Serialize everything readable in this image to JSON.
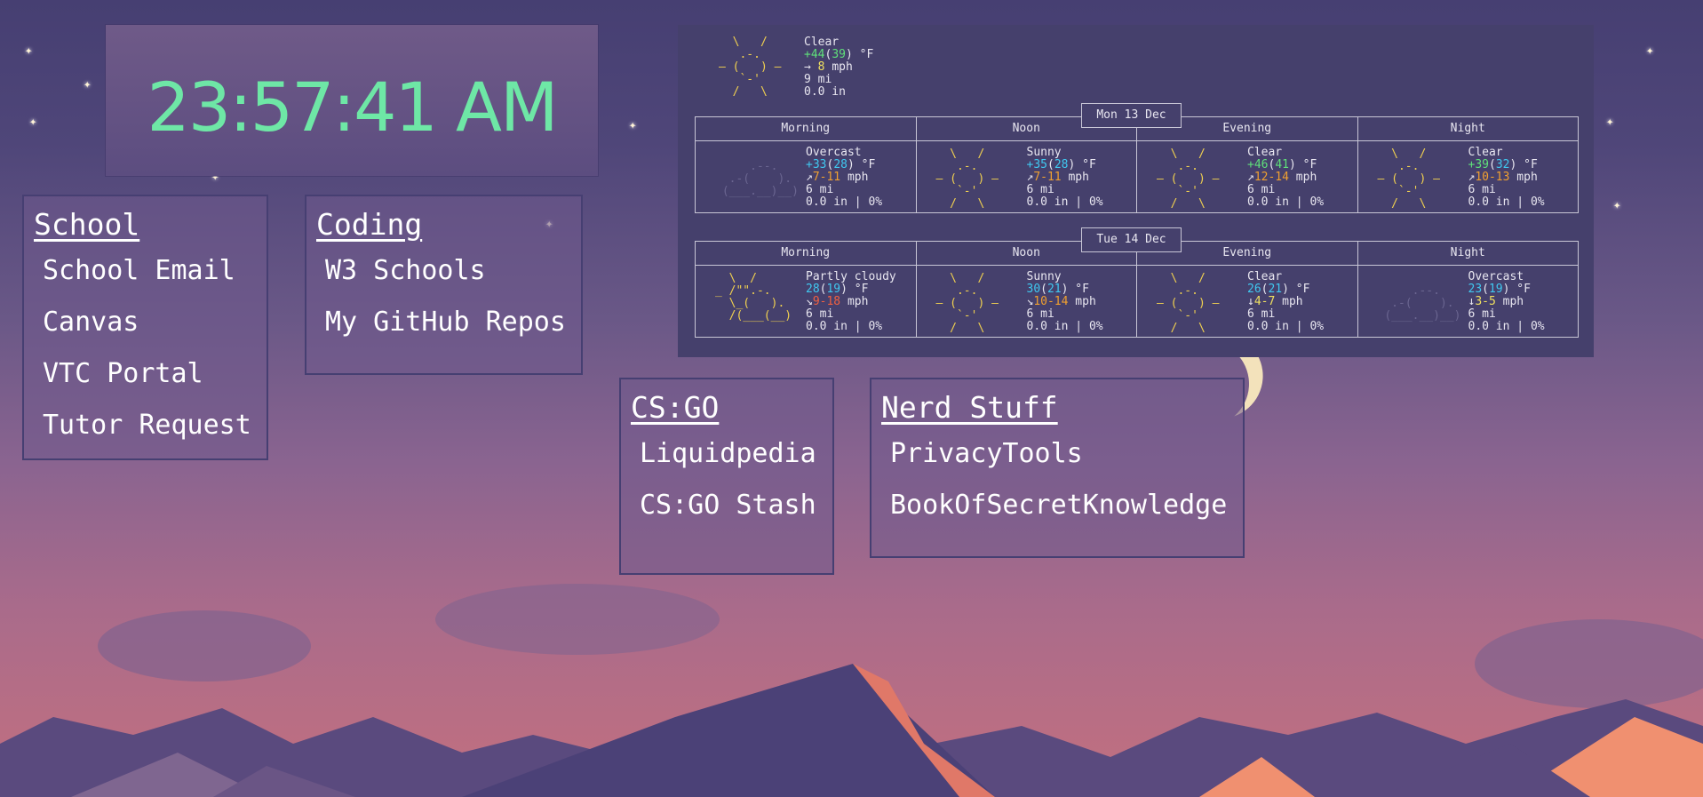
{
  "clock": {
    "time": "23:57:41 AM"
  },
  "groups": [
    {
      "title": "School",
      "links": [
        "School Email",
        "Canvas",
        "VTC Portal",
        "Tutor Request"
      ]
    },
    {
      "title": "Coding",
      "links": [
        "W3 Schools",
        "My GitHub Repos"
      ]
    },
    {
      "title": "CS:GO",
      "links": [
        "Liquidpedia",
        "CS:GO Stash"
      ]
    },
    {
      "title": "Nerd Stuff",
      "links": [
        "PrivacyTools",
        "BookOfSecretKnowledge"
      ]
    }
  ],
  "weather": {
    "current": {
      "condition": "Clear",
      "temp": "+44",
      "feels": "39",
      "unit": "°F",
      "wind_dir": "→",
      "wind": "8",
      "wind_unit": "mph",
      "visibility": "9 mi",
      "precip": "0.0 in"
    },
    "days": [
      {
        "date": "Mon 13 Dec",
        "periods": [
          "Morning",
          "Noon",
          "Evening",
          "Night"
        ],
        "slots": [
          {
            "icon": "cloud-icon",
            "condition": "Overcast",
            "temp": "+33",
            "feels": "28",
            "wind_dir": "↗",
            "wind": "7-11",
            "vis": "6 mi",
            "precip": "0.0 in | 0%"
          },
          {
            "icon": "sun-icon",
            "condition": "Sunny",
            "temp": "+35",
            "feels": "28",
            "wind_dir": "↗",
            "wind": "7-11",
            "vis": "6 mi",
            "precip": "0.0 in | 0%"
          },
          {
            "icon": "sun-icon",
            "condition": "Clear",
            "temp": "+46",
            "feels": "41",
            "wind_dir": "↗",
            "wind": "12-14",
            "vis": "6 mi",
            "precip": "0.0 in | 0%"
          },
          {
            "icon": "sun-icon",
            "condition": "Clear",
            "temp": "+39",
            "feels": "32",
            "wind_dir": "↗",
            "wind": "10-13",
            "vis": "6 mi",
            "precip": "0.0 in | 0%"
          }
        ]
      },
      {
        "date": "Tue 14 Dec",
        "periods": [
          "Morning",
          "Noon",
          "Evening",
          "Night"
        ],
        "slots": [
          {
            "icon": "partly-cloudy-icon",
            "condition": "Partly cloudy",
            "temp": "28",
            "feels": "19",
            "wind_dir": "↘",
            "wind": "9-18",
            "vis": "6 mi",
            "precip": "0.0 in | 0%"
          },
          {
            "icon": "sun-icon",
            "condition": "Sunny",
            "temp": "30",
            "feels": "21",
            "wind_dir": "↘",
            "wind": "10-14",
            "vis": "6 mi",
            "precip": "0.0 in | 0%"
          },
          {
            "icon": "sun-icon",
            "condition": "Clear",
            "temp": "26",
            "feels": "21",
            "wind_dir": "↓",
            "wind": "4-7",
            "vis": "6 mi",
            "precip": "0.0 in | 0%"
          },
          {
            "icon": "cloud-icon",
            "condition": "Overcast",
            "temp": "23",
            "feels": "19",
            "wind_dir": "↓",
            "wind": "3-5",
            "vis": "6 mi",
            "precip": "0.0 in | 0%"
          }
        ]
      }
    ]
  },
  "colors": {
    "clock": "#6ee7a6",
    "panel": "#45406c",
    "border": "#463f72"
  }
}
